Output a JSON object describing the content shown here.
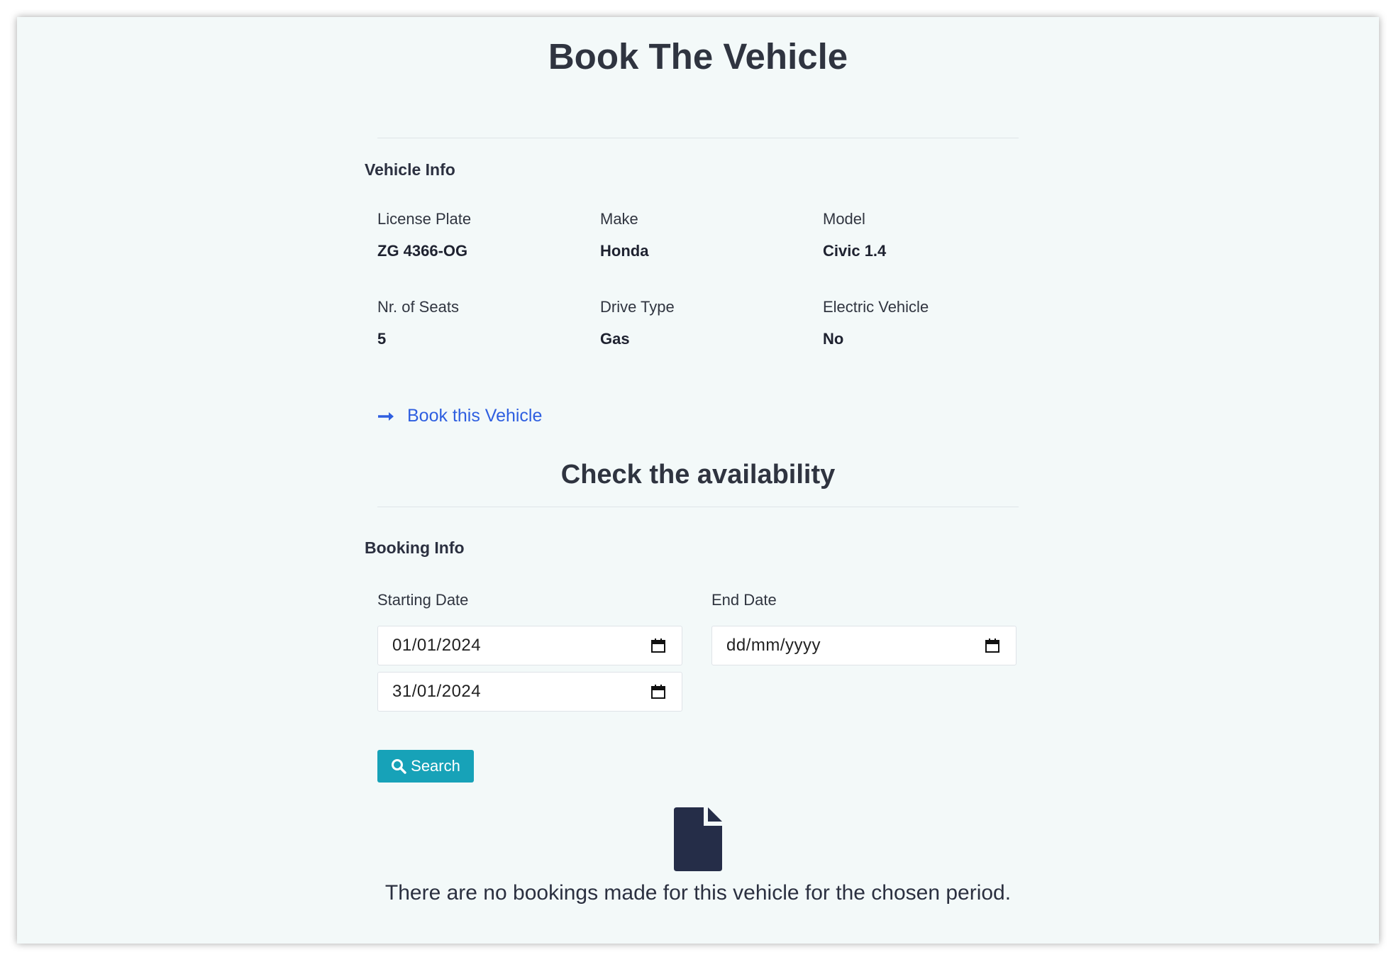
{
  "page": {
    "title": "Book The Vehicle"
  },
  "vehicle_info": {
    "heading": "Vehicle Info",
    "license_plate": {
      "label": "License Plate",
      "value": "ZG 4366-OG"
    },
    "make": {
      "label": "Make",
      "value": "Honda"
    },
    "model": {
      "label": "Model",
      "value": "Civic 1.4"
    },
    "seats": {
      "label": "Nr. of Seats",
      "value": "5"
    },
    "drive_type": {
      "label": "Drive Type",
      "value": "Gas"
    },
    "electric": {
      "label": "Electric Vehicle",
      "value": "No"
    }
  },
  "book_link": {
    "label": "Book this Vehicle",
    "icon": "arrow-right-icon"
  },
  "availability": {
    "title": "Check the availability"
  },
  "booking_info": {
    "heading": "Booking Info",
    "starting_date": {
      "label": "Starting Date",
      "value": "01/01/2024",
      "second_value": "31/01/2024"
    },
    "end_date": {
      "label": "End Date",
      "placeholder": "dd/mm/yyyy"
    }
  },
  "search": {
    "label": "Search",
    "icon": "search-icon",
    "color": "#17a2b8"
  },
  "empty_state": {
    "icon": "file-icon",
    "message": "There are no bookings made for this vehicle for the chosen period."
  },
  "colors": {
    "background": "#f3f9f9",
    "link": "#2f5fe0",
    "text": "#2f3440",
    "icon": "#252d48"
  }
}
